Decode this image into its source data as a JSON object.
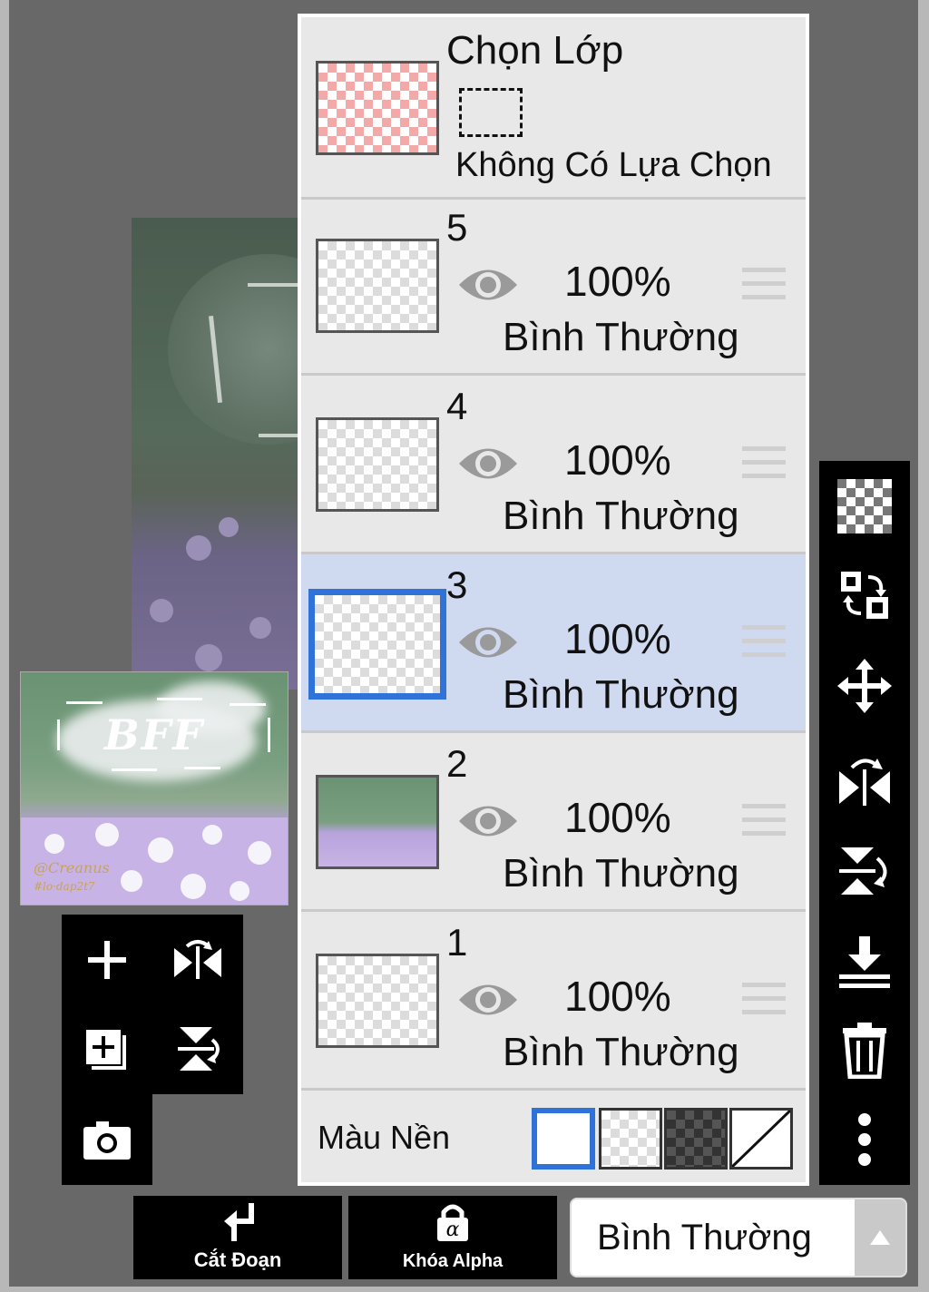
{
  "selection": {
    "title": "Chọn Lớp",
    "status": "Không Có Lựa Chọn"
  },
  "layers": [
    {
      "number": "5",
      "opacity": "100%",
      "blend": "Bình Thường",
      "selected": false
    },
    {
      "number": "4",
      "opacity": "100%",
      "blend": "Bình Thường",
      "selected": false
    },
    {
      "number": "3",
      "opacity": "100%",
      "blend": "Bình Thường",
      "selected": true
    },
    {
      "number": "2",
      "opacity": "100%",
      "blend": "Bình Thường",
      "selected": false
    },
    {
      "number": "1",
      "opacity": "100%",
      "blend": "Bình Thường",
      "selected": false
    }
  ],
  "background": {
    "label": "Màu Nền",
    "options": [
      "white",
      "transparent",
      "dark-checker",
      "none"
    ],
    "selected": "white"
  },
  "preview": {
    "title": "BFF",
    "signature_line1": "@Creanus",
    "signature_line2": "#lo·dap2t7"
  },
  "bottom_bar": {
    "clip_label": "Cắt Đoạn",
    "alpha_lock_label": "Khóa Alpha",
    "blend_mode": "Bình Thường"
  },
  "colors": {
    "accent": "#2f72d8",
    "selected_row": "#cfdaf0",
    "panel": "#e8e8e8",
    "toolbar": "#000000"
  },
  "icons": {
    "left_toolbar": [
      "plus-icon",
      "flip-horizontal-icon",
      "add-layer-icon",
      "flip-vertical-icon",
      "camera-icon"
    ],
    "right_toolbar": [
      "checker-icon",
      "swap-icon",
      "move-icon",
      "flip-horizontal-icon",
      "flip-vertical-icon",
      "merge-down-icon",
      "trash-icon",
      "more-icon"
    ]
  }
}
